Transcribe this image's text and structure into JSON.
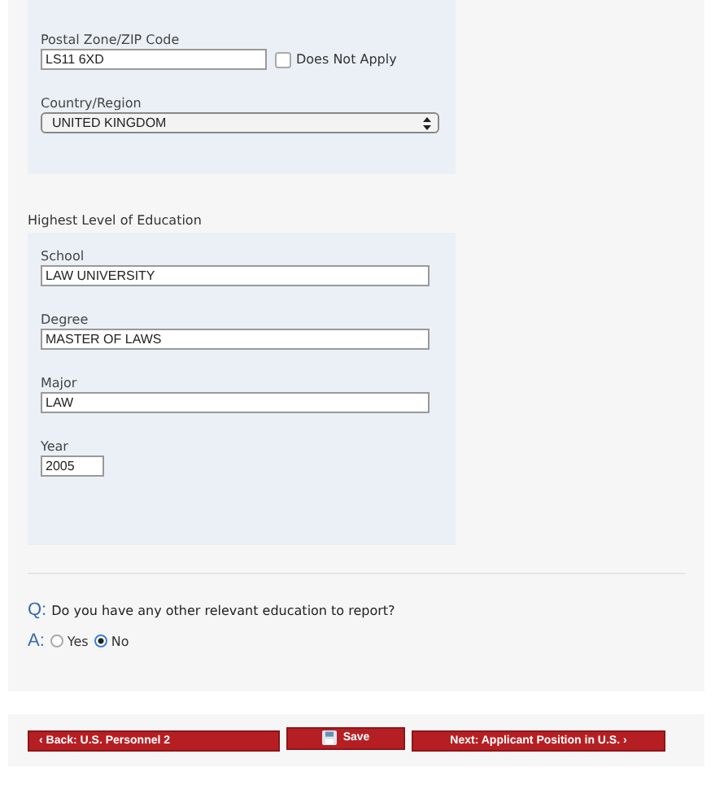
{
  "address": {
    "postal": {
      "label": "Postal Zone/ZIP Code",
      "value": "LS11 6XD",
      "does_not_apply": {
        "label": "Does Not Apply",
        "checked": false
      }
    },
    "country": {
      "label": "Country/Region",
      "value": "UNITED KINGDOM"
    }
  },
  "education": {
    "title": "Highest Level of Education",
    "fields": [
      {
        "label": "School",
        "value": "LAW UNIVERSITY",
        "kind": "wide"
      },
      {
        "label": "Degree",
        "value": "MASTER OF LAWS",
        "kind": "wide"
      },
      {
        "label": "Major",
        "value": "LAW",
        "kind": "wide"
      },
      {
        "label": "Year",
        "value": "2005",
        "kind": "short"
      }
    ]
  },
  "question": {
    "q_mark": "Q:",
    "text": "Do you have any other relevant education to report?",
    "a_mark": "A:",
    "options": [
      {
        "label": "Yes",
        "selected": false
      },
      {
        "label": "No",
        "selected": true
      }
    ]
  },
  "buttons": [
    {
      "label": "‹ Back: U.S. Personnel 2",
      "kind": "back"
    },
    {
      "label": "Save",
      "kind": "save"
    },
    {
      "label": "Next: Applicant Position in U.S. ›",
      "kind": "next"
    }
  ]
}
